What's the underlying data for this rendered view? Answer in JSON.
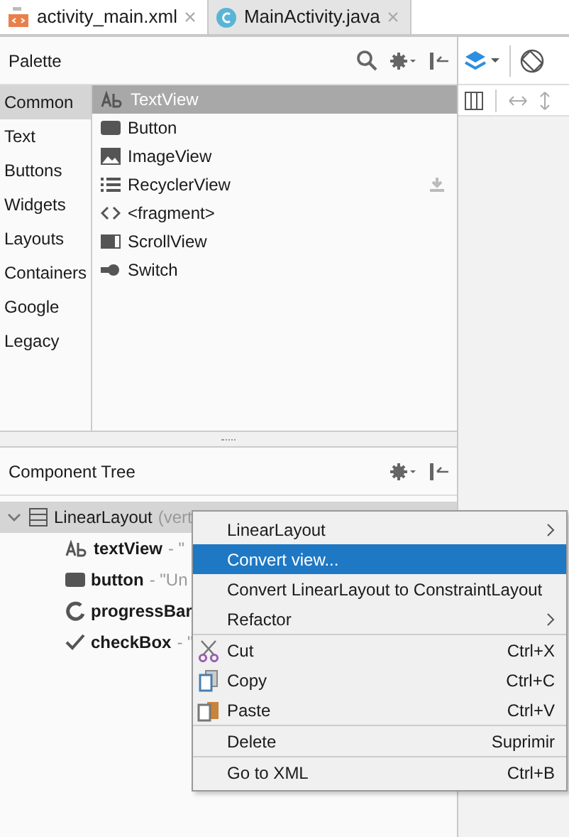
{
  "tabs": [
    {
      "label": "activity_main.xml",
      "kind": "xml",
      "selected": true
    },
    {
      "label": "MainActivity.java",
      "kind": "java",
      "selected": false
    }
  ],
  "palette": {
    "title": "Palette",
    "categories": [
      {
        "label": "Common",
        "selected": true
      },
      {
        "label": "Text",
        "selected": false
      },
      {
        "label": "Buttons",
        "selected": false
      },
      {
        "label": "Widgets",
        "selected": false
      },
      {
        "label": "Layouts",
        "selected": false
      },
      {
        "label": "Containers",
        "selected": false
      },
      {
        "label": "Google",
        "selected": false
      },
      {
        "label": "Legacy",
        "selected": false
      }
    ],
    "items": [
      {
        "label": "TextView",
        "kind": "text",
        "selected": true
      },
      {
        "label": "Button",
        "kind": "button",
        "selected": false
      },
      {
        "label": "ImageView",
        "kind": "image",
        "selected": false
      },
      {
        "label": "RecyclerView",
        "kind": "list",
        "selected": false,
        "download": true
      },
      {
        "label": "<fragment>",
        "kind": "code",
        "selected": false
      },
      {
        "label": "ScrollView",
        "kind": "scroll",
        "selected": false
      },
      {
        "label": "Switch",
        "kind": "switch",
        "selected": false
      }
    ]
  },
  "component_tree": {
    "title": "Component Tree",
    "root": {
      "name": "LinearLayout",
      "detail": "(vert",
      "expanded": true,
      "selected": true,
      "children": [
        {
          "name": "textView",
          "detail": "- \"",
          "kind": "text"
        },
        {
          "name": "button",
          "detail": "- \"Un",
          "kind": "button"
        },
        {
          "name": "progressBar",
          "kind": "progress"
        },
        {
          "name": "checkBox",
          "detail": "- \"",
          "kind": "check"
        }
      ]
    }
  },
  "context_menu": [
    [
      {
        "label": "LinearLayout",
        "submenu": true,
        "selected": false
      },
      {
        "label": "Convert view...",
        "selected": true
      },
      {
        "label": "Convert LinearLayout to ConstraintLayout",
        "selected": false
      },
      {
        "label": "Refactor",
        "submenu": true,
        "selected": false
      }
    ],
    [
      {
        "label": "Cut",
        "shortcut": "Ctrl+X",
        "kind": "cut",
        "selected": false
      },
      {
        "label": "Copy",
        "shortcut": "Ctrl+C",
        "kind": "copy",
        "selected": false
      },
      {
        "label": "Paste",
        "shortcut": "Ctrl+V",
        "kind": "paste",
        "selected": false
      }
    ],
    [
      {
        "label": "Delete",
        "shortcut": "Suprimir",
        "selected": false
      }
    ],
    [
      {
        "label": "Go to XML",
        "shortcut": "Ctrl+B",
        "selected": false
      }
    ]
  ]
}
